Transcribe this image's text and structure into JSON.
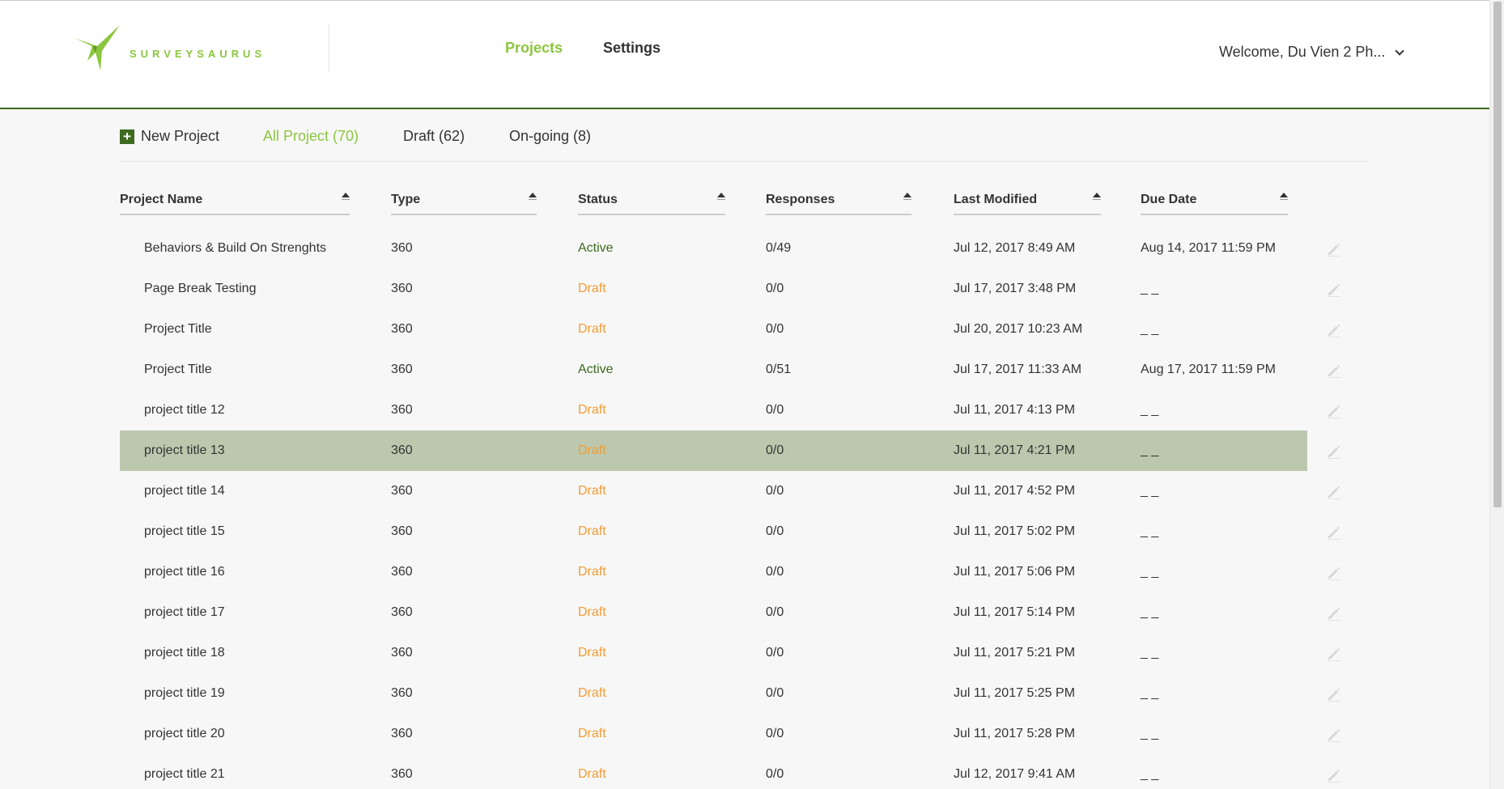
{
  "header": {
    "logo_text": "SURVEYSAURUS",
    "nav": {
      "projects": "Projects",
      "settings": "Settings"
    },
    "user_welcome": "Welcome, Du Vien 2 Ph..."
  },
  "tabs": {
    "new_project": "New Project",
    "all": "All Project (70)",
    "draft": "Draft (62)",
    "ongoing": "On-going (8)"
  },
  "columns": [
    "Project Name",
    "Type",
    "Status",
    "Responses",
    "Last Modified",
    "Due Date"
  ],
  "rows": [
    {
      "name": "Behaviors & Build On Strenghts",
      "type": "360",
      "status": "Active",
      "responses": "0/49",
      "modified": "Jul 12, 2017 8:49 AM",
      "due": "Aug 14, 2017 11:59 PM"
    },
    {
      "name": "Page Break Testing",
      "type": "360",
      "status": "Draft",
      "responses": "0/0",
      "modified": "Jul 17, 2017 3:48 PM",
      "due": "_ _"
    },
    {
      "name": "Project Title",
      "type": "360",
      "status": "Draft",
      "responses": "0/0",
      "modified": "Jul 20, 2017 10:23 AM",
      "due": "_ _"
    },
    {
      "name": "Project Title",
      "type": "360",
      "status": "Active",
      "responses": "0/51",
      "modified": "Jul 17, 2017 11:33 AM",
      "due": "Aug 17, 2017 11:59 PM"
    },
    {
      "name": "project title 12",
      "type": "360",
      "status": "Draft",
      "responses": "0/0",
      "modified": "Jul 11, 2017 4:13 PM",
      "due": "_ _"
    },
    {
      "name": "project title 13",
      "type": "360",
      "status": "Draft",
      "responses": "0/0",
      "modified": "Jul 11, 2017 4:21 PM",
      "due": "_ _"
    },
    {
      "name": "project title 14",
      "type": "360",
      "status": "Draft",
      "responses": "0/0",
      "modified": "Jul 11, 2017 4:52 PM",
      "due": "_ _"
    },
    {
      "name": "project title 15",
      "type": "360",
      "status": "Draft",
      "responses": "0/0",
      "modified": "Jul 11, 2017 5:02 PM",
      "due": "_ _"
    },
    {
      "name": "project title 16",
      "type": "360",
      "status": "Draft",
      "responses": "0/0",
      "modified": "Jul 11, 2017 5:06 PM",
      "due": "_ _"
    },
    {
      "name": "project title 17",
      "type": "360",
      "status": "Draft",
      "responses": "0/0",
      "modified": "Jul 11, 2017 5:14 PM",
      "due": "_ _"
    },
    {
      "name": "project title 18",
      "type": "360",
      "status": "Draft",
      "responses": "0/0",
      "modified": "Jul 11, 2017 5:21 PM",
      "due": "_ _"
    },
    {
      "name": "project title 19",
      "type": "360",
      "status": "Draft",
      "responses": "0/0",
      "modified": "Jul 11, 2017 5:25 PM",
      "due": "_ _"
    },
    {
      "name": "project title 20",
      "type": "360",
      "status": "Draft",
      "responses": "0/0",
      "modified": "Jul 11, 2017 5:28 PM",
      "due": "_ _"
    },
    {
      "name": "project title 21",
      "type": "360",
      "status": "Draft",
      "responses": "0/0",
      "modified": "Jul 12, 2017 9:41 AM",
      "due": "_ _"
    }
  ],
  "selected_row": 5,
  "colors": {
    "accent": "#8cc63f",
    "brand_dark": "#3d6b1f",
    "draft": "#f39c32",
    "selected_row": "#bcc8ae"
  },
  "icons": {
    "sort": "sort-up-icon",
    "edit": "pencil-icon",
    "add": "plus-icon",
    "user_menu": "chevron-down-icon"
  }
}
